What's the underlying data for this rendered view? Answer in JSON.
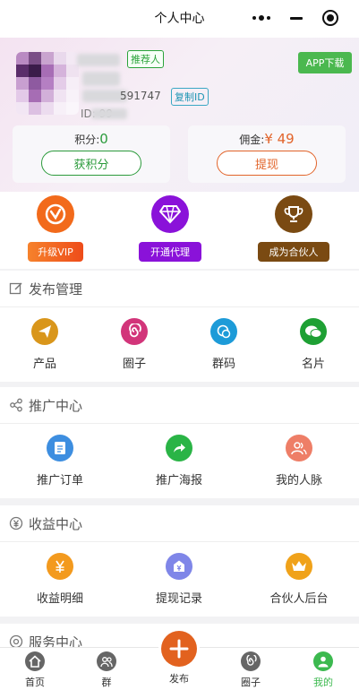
{
  "topbar": {
    "title": "个人中心"
  },
  "profile": {
    "recommender_tag": "推荐人",
    "uid_tail": "591747",
    "copy_id_label": "复制ID",
    "id_line": "ID:  99",
    "app_download": "APP下载"
  },
  "points": {
    "label": "积分:",
    "value": "0",
    "button": "获积分"
  },
  "commission": {
    "label": "佣金:",
    "value": "¥ 49",
    "button": "提现"
  },
  "vip_row": [
    {
      "label": "升级VIP",
      "icon": "vip-upgrade-icon",
      "color": "#f26a1b"
    },
    {
      "label": "开通代理",
      "icon": "diamond-icon",
      "color": "#8a12d9"
    },
    {
      "label": "成为合伙人",
      "icon": "trophy-icon",
      "color": "#7a4a12"
    }
  ],
  "sections": [
    {
      "title": "发布管理",
      "icon": "edit-icon",
      "items": [
        {
          "label": "产品",
          "icon": "paper-plane-icon",
          "color": "#d9961b"
        },
        {
          "label": "圈子",
          "icon": "spiral-icon",
          "color": "#d2357a"
        },
        {
          "label": "群码",
          "icon": "group-chat-icon",
          "color": "#1d9bd8"
        },
        {
          "label": "名片",
          "icon": "wechat-icon",
          "color": "#1ea034"
        }
      ]
    },
    {
      "title": "推广中心",
      "icon": "share-icon",
      "items": [
        {
          "label": "推广订单",
          "icon": "document-icon",
          "color": "#3d8ee0"
        },
        {
          "label": "推广海报",
          "icon": "share-arrow-icon",
          "color": "#2ab446"
        },
        {
          "label": "我的人脉",
          "icon": "people-icon",
          "color": "#ee7e67"
        }
      ]
    },
    {
      "title": "收益中心",
      "icon": "income-icon",
      "items": [
        {
          "label": "收益明细",
          "icon": "yuan-icon",
          "color": "#f39a1e"
        },
        {
          "label": "提现记录",
          "icon": "wallet-icon",
          "color": "#7f86e8"
        },
        {
          "label": "合伙人后台",
          "icon": "crown-icon",
          "color": "#f0a21a"
        }
      ]
    },
    {
      "title": "服务中心",
      "icon": "service-icon",
      "items": []
    }
  ],
  "tabbar": [
    {
      "label": "首页",
      "icon": "home-icon"
    },
    {
      "label": "群",
      "icon": "group-icon"
    },
    {
      "label": "发布",
      "icon": "plus-icon"
    },
    {
      "label": "圈子",
      "icon": "circle-icon"
    },
    {
      "label": "我的",
      "icon": "user-icon",
      "active": true
    }
  ]
}
